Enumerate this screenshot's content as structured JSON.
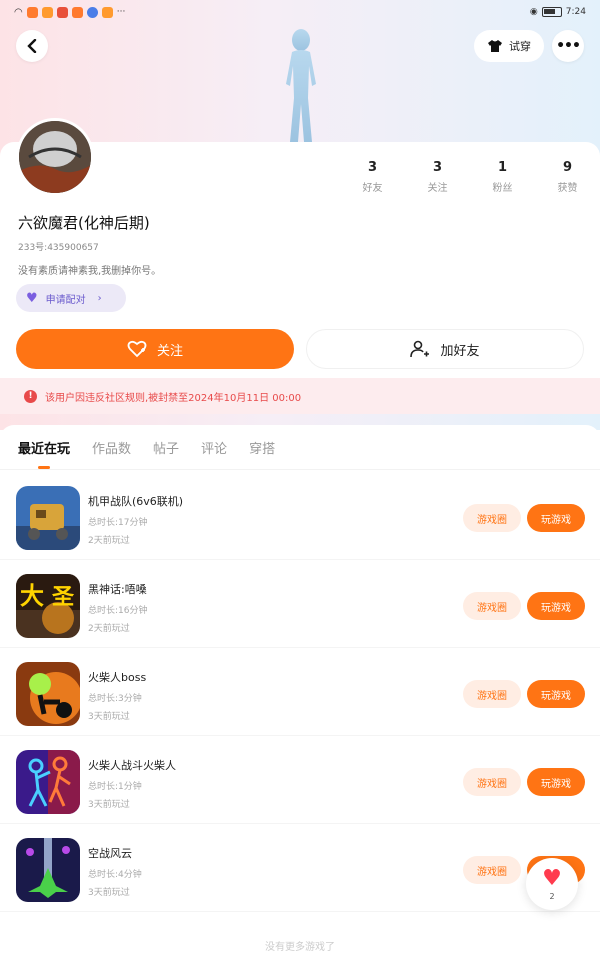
{
  "status_bar": {
    "time": "7:24"
  },
  "header": {
    "try_on_label": "试穿"
  },
  "profile": {
    "stats": [
      {
        "num": "3",
        "label": "好友"
      },
      {
        "num": "3",
        "label": "关注"
      },
      {
        "num": "1",
        "label": "粉丝"
      },
      {
        "num": "9",
        "label": "获赞"
      }
    ],
    "nickname": "六欲魔君(化神后期)",
    "uid": "233号:435900657",
    "bio": "没有素质请神素我,我删掉你号。",
    "pair_label": "申请配对",
    "follow_label": "关注",
    "add_friend_label": "加好友",
    "ban_notice": "该用户因违反社区规则,被封禁至2024年10月11日 00:00"
  },
  "tabs": [
    {
      "label": "最近在玩",
      "active": true
    },
    {
      "label": "作品数",
      "active": false
    },
    {
      "label": "帖子",
      "active": false
    },
    {
      "label": "评论",
      "active": false
    },
    {
      "label": "穿搭",
      "active": false
    }
  ],
  "games": [
    {
      "name": "机甲战队(6v6联机)",
      "time": "总时长:17分钟",
      "last": "2天前玩过",
      "icon": "mech-game-icon"
    },
    {
      "name": "黑神话:唔嗓",
      "time": "总时长:16分钟",
      "last": "2天前玩过",
      "icon": "wukong-game-icon"
    },
    {
      "name": "火柴人boss",
      "time": "总时长:3分钟",
      "last": "3天前玩过",
      "icon": "stickman-boss-icon"
    },
    {
      "name": "火柴人战斗火柴人",
      "time": "总时长:1分钟",
      "last": "3天前玩过",
      "icon": "stickman-fight-icon"
    },
    {
      "name": "空战风云",
      "time": "总时长:4分钟",
      "last": "3天前玩过",
      "icon": "air-battle-icon"
    }
  ],
  "game_buttons": {
    "circle": "游戏圈",
    "play": "玩游戏"
  },
  "fab": {
    "count": "2"
  },
  "footer": "没有更多游戏了",
  "colors": {
    "accent": "#ff7414",
    "danger": "#e84a4a",
    "pair": "#6a5acd"
  }
}
